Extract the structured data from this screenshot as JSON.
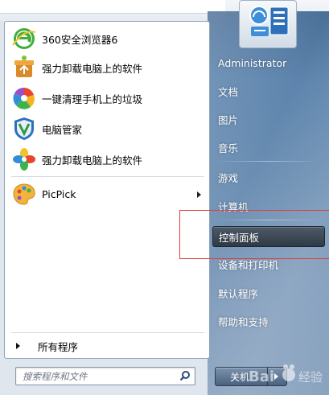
{
  "programs": [
    {
      "label": "360安全浏览器6",
      "icon": "360-browser-icon"
    },
    {
      "label": "强力卸载电脑上的软件",
      "icon": "uninstall-box-icon"
    },
    {
      "label": "一键清理手机上的垃圾",
      "icon": "phone-cleaner-icon"
    },
    {
      "label": "电脑管家",
      "icon": "pc-manager-shield-icon"
    },
    {
      "label": "强力卸载电脑上的软件",
      "icon": "pinwheel-icon"
    },
    {
      "label": "PicPick",
      "icon": "picpick-palette-icon"
    }
  ],
  "all_programs": "所有程序",
  "search": {
    "placeholder": "搜索程序和文件"
  },
  "right": {
    "username": "Administrator",
    "items": [
      "文档",
      "图片",
      "音乐",
      "游戏",
      "计算机",
      "控制面板",
      "设备和打印机",
      "默认程序",
      "帮助和支持"
    ]
  },
  "shutdown": {
    "label": "关机"
  },
  "watermark": "Bai 经验",
  "colors": {
    "highlight": "#3a4654",
    "annotation": "#e0403a",
    "glass": "#5d84ad"
  }
}
